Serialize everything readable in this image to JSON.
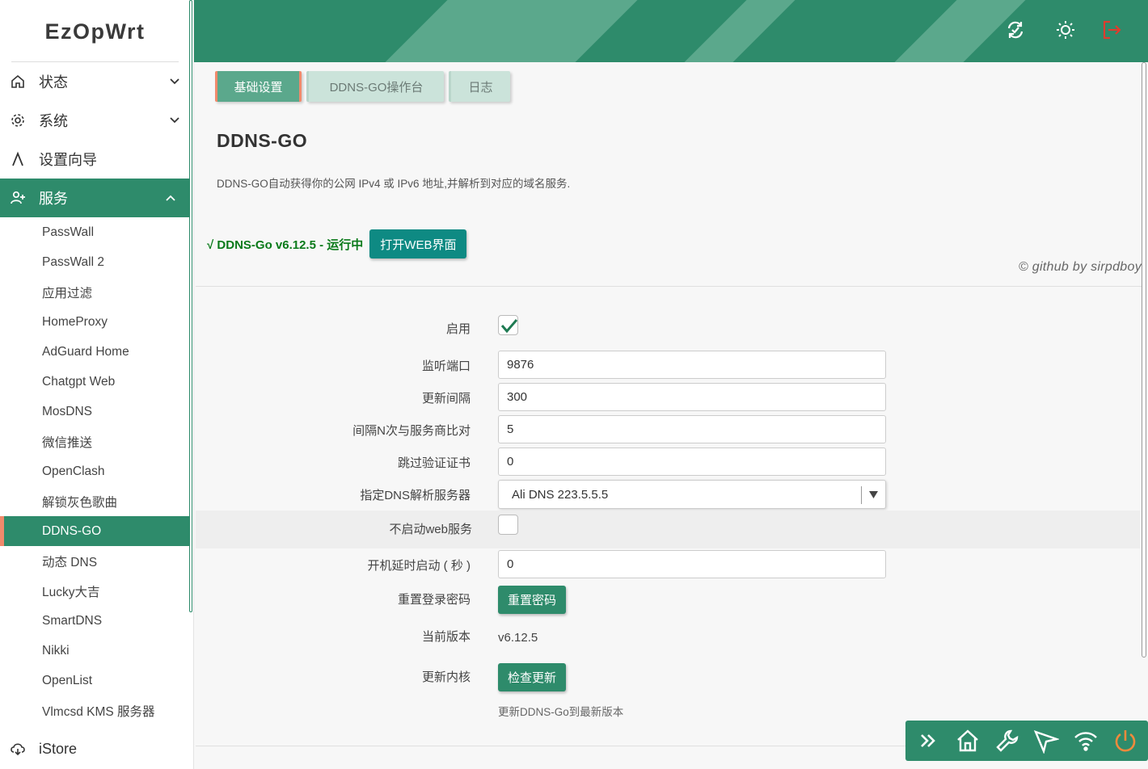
{
  "brand": "EzOpWrt",
  "sidebar": {
    "top_items": [
      {
        "label": "状态",
        "icon": "home-icon"
      },
      {
        "label": "系统",
        "icon": "gear-icon"
      },
      {
        "label": "设置向导",
        "icon": "wizard-icon"
      },
      {
        "label": "服务",
        "icon": "user-plus-icon"
      }
    ],
    "service_items": [
      "PassWall",
      "PassWall 2",
      "应用过滤",
      "HomeProxy",
      "AdGuard Home",
      "Chatgpt Web",
      "MosDNS",
      "微信推送",
      "OpenClash",
      "解锁灰色歌曲",
      "DDNS-GO",
      "动态 DNS",
      "Lucky大吉",
      "SmartDNS",
      "Nikki",
      "OpenList",
      "Vlmcsd KMS 服务器"
    ],
    "active_service": "DDNS-GO",
    "bottom_item": {
      "label": "iStore",
      "icon": "cloud-download-icon"
    }
  },
  "header": {
    "icons": [
      "refresh-icon",
      "sun-icon",
      "logout-icon"
    ]
  },
  "tabs": [
    "基础设置",
    "DDNS-GO操作台",
    "日志"
  ],
  "page": {
    "title": "DDNS-GO",
    "description": "DDNS-GO自动获得你的公网 IPv4 或 IPv6 地址,并解析到对应的域名服务.",
    "status": "√  DDNS-Go v6.12.5 - 运行中",
    "open_web_button": "打开WEB界面",
    "credit": "© github by sirpdboy"
  },
  "form": {
    "enable_label": "启用",
    "enable_checked": true,
    "port_label": "监听端口",
    "port_value": "9876",
    "interval_label": "更新间隔",
    "interval_value": "300",
    "compare_label": "间隔N次与服务商比对",
    "compare_value": "5",
    "skip_verify_label": "跳过验证证书",
    "skip_verify_value": "0",
    "dns_label": "指定DNS解析服务器",
    "dns_value": "Ali DNS 223.5.5.5",
    "noweb_label": "不启动web服务",
    "noweb_checked": false,
    "delay_label": "开机延时启动 ( 秒 )",
    "delay_value": "0",
    "reset_label": "重置登录密码",
    "reset_button": "重置密码",
    "version_label": "当前版本",
    "version_value": "v6.12.5",
    "update_label": "更新内核",
    "update_button": "检查更新",
    "update_hint": "更新DDNS-Go到最新版本"
  },
  "floatbar": {
    "icons": [
      "double-chevron-right-icon",
      "home-icon",
      "wrench-icon",
      "send-icon",
      "wifi-icon",
      "power-icon"
    ]
  },
  "colors": {
    "primary": "#2e8b6b",
    "accent": "#f08a6c",
    "teal_button": "#0e8a83",
    "status_green": "#0a7a1a",
    "logout_red": "#e03b2e"
  }
}
